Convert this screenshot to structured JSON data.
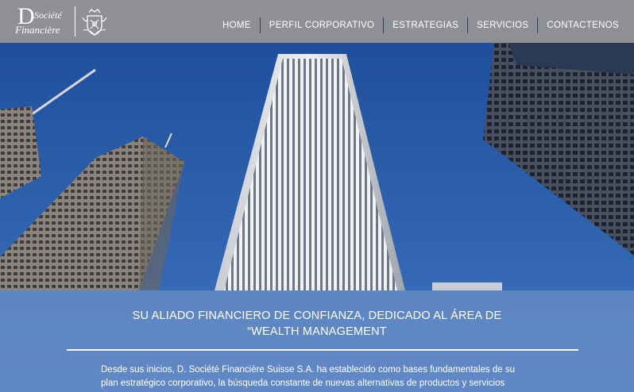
{
  "brand": {
    "initial": "D",
    "name_line1": "Société",
    "name_line2": "Financière"
  },
  "nav": {
    "items": [
      "HOME",
      "PERFIL CORPORATIVO",
      "ESTRATEGIAS",
      "SERVICIOS",
      "CONTACTENOS"
    ]
  },
  "hero": {
    "headline_line1": "SU ALIADO FINANCIERO DE CONFIANZA, DEDICADO AL ÁREA DE",
    "headline_line2": "“WEALTH MANAGEMENT",
    "intro_line1": "Desde sus inicios, D. Société Financière Suisse S.A. ha establecido como bases fundamentales de su",
    "intro_line2": "plan estratégico corporativo, la búsqueda constante de nuevas alternativas de productos y servicios"
  },
  "colors": {
    "header_bg": "#8f9094",
    "sky": "#2f5fa8",
    "overlay": "#688cc6",
    "nav_separator": "#2f3a63"
  },
  "icons": [
    "crest-icon"
  ]
}
